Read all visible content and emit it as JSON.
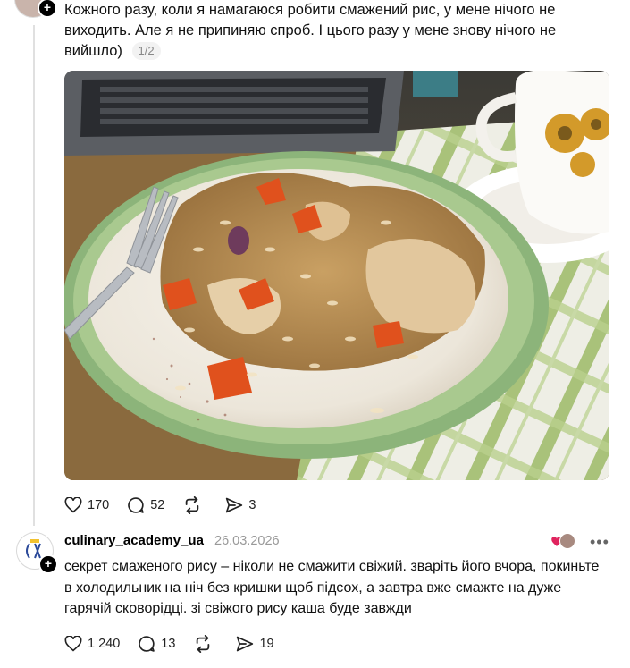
{
  "post": {
    "text": "Кожного разу, коли я намагаюся робити смажений рис, у мене нічого не виходить. Але я не припиняю спроб. І цього разу у мене знову нічого не вийшло)",
    "counter": "1/2",
    "image_alt": "fried-rice-photo",
    "stats": {
      "likes": "170",
      "comments": "52",
      "reposts": "",
      "shares": "3"
    }
  },
  "reply": {
    "username": "culinary_academy_ua",
    "date": "26.03.2026",
    "text": "секрет смаженого рису – ніколи не смажити свіжий. зваріть його вчора, покиньте в холодильник на ніч без кришки щоб підсох, а завтра вже смажте на дуже гарячій сковорідці. зі свіжого рису каша буде завжди",
    "stats": {
      "likes": "1 240",
      "comments": "13",
      "reposts": "",
      "shares": "19"
    }
  },
  "colors": {
    "heart_badge": "#e0245e",
    "muted": "#999999",
    "line": "#e0e0e0"
  }
}
